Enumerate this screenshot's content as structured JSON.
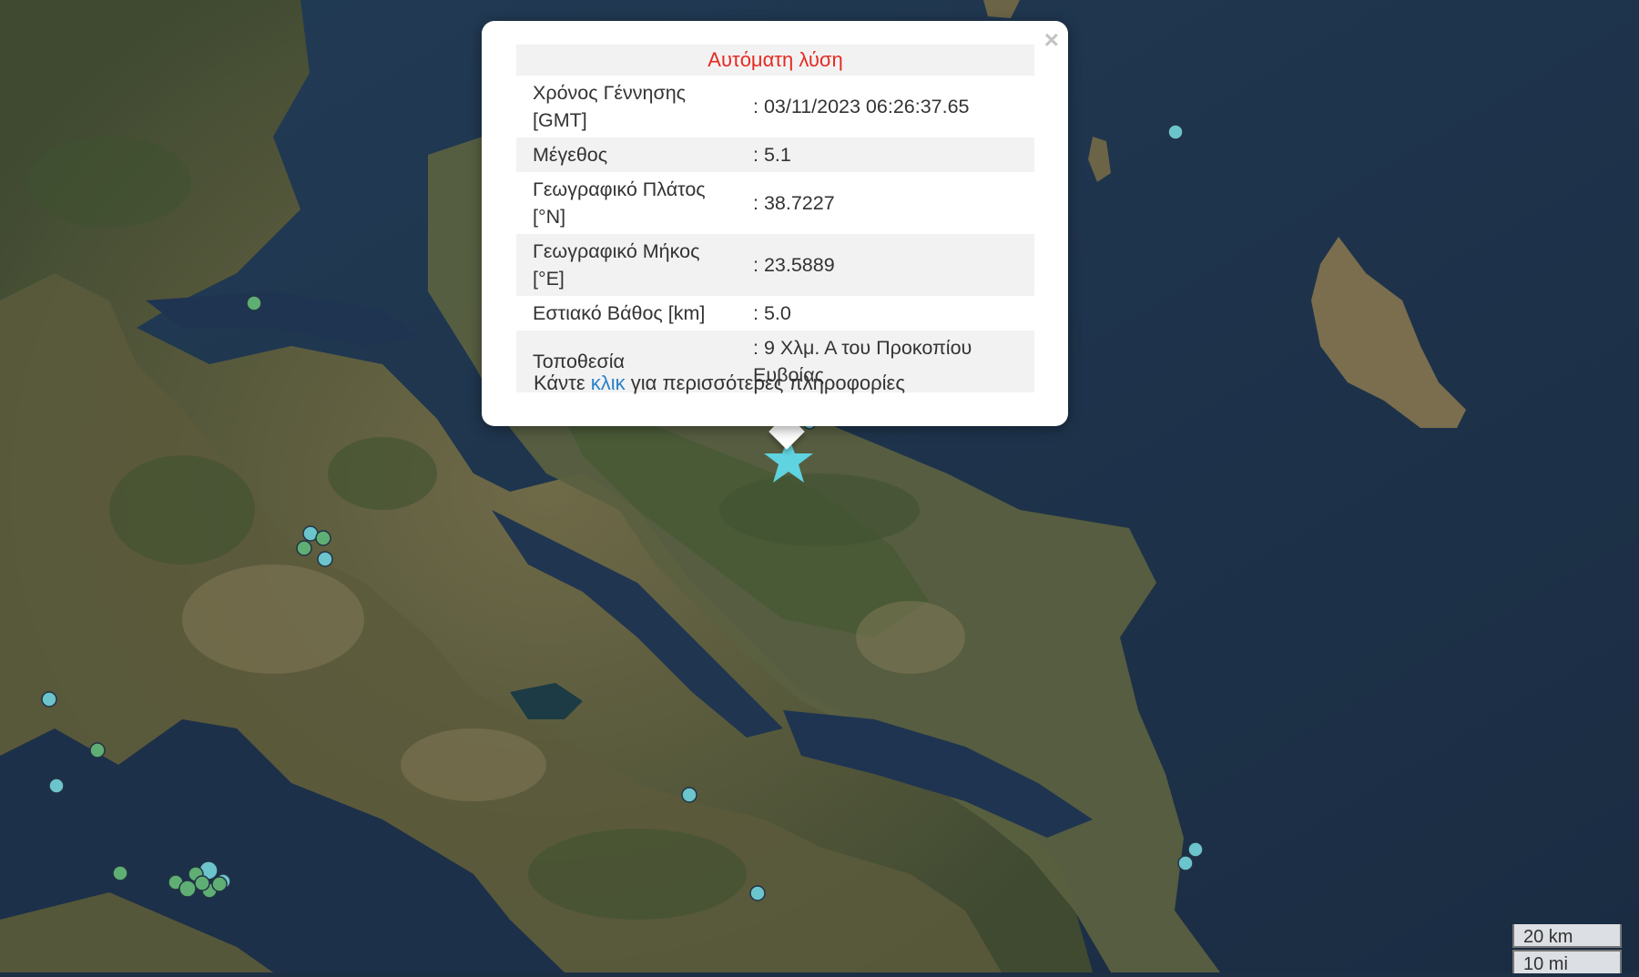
{
  "popup": {
    "title": "Αυτόματη λύση",
    "close_label": "×",
    "rows": [
      {
        "label": "Χρόνος Γέννησης [GMT]",
        "value": ": 03/11/2023 06:26:37.65"
      },
      {
        "label": "Μέγεθος",
        "value": ": 5.1"
      },
      {
        "label": "Γεωγραφικό Πλάτος [°N]",
        "value": ": 38.7227"
      },
      {
        "label": "Γεωγραφικό Μήκος [°E]",
        "value": ": 23.5889"
      },
      {
        "label": "Εστιακό Βάθος [km]",
        "value": ": 5.0"
      },
      {
        "label": "Τοποθεσία",
        "value": ": 9 Χλμ. Α του Προκοπίου Ευβοίας"
      }
    ],
    "more_prefix": "Κάντε",
    "more_link": "κλικ",
    "more_suffix": "για περισσότερες πληροφορίες"
  },
  "scale": {
    "km": "20 km",
    "mi": "10 mi"
  },
  "colors": {
    "star": "#5fd3e0",
    "marker_blue": "#6cc4cc",
    "marker_green": "#5fae74",
    "title_red": "#e52a22",
    "link": "#2a81cb"
  },
  "epicenter_icon": "star-icon"
}
